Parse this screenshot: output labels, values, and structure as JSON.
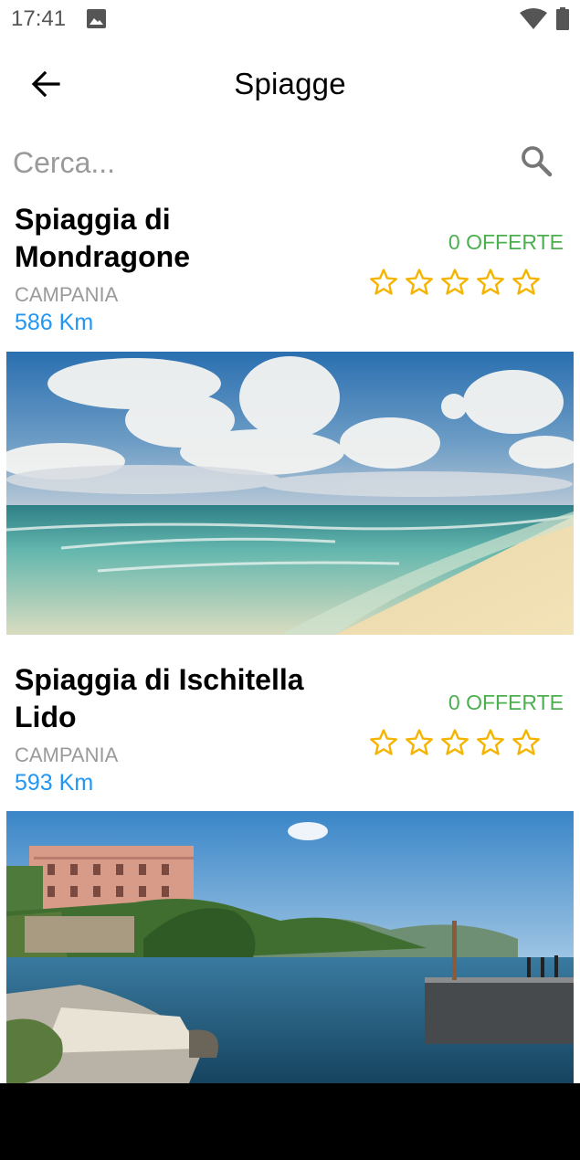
{
  "status_bar": {
    "time": "17:41"
  },
  "app_bar": {
    "title": "Spiagge"
  },
  "search": {
    "placeholder": "Cerca..."
  },
  "beaches": [
    {
      "name": "Spiaggia di Mondragone",
      "region": "CAMPANIA",
      "distance": "586 Km",
      "offers": "0 OFFERTE",
      "rating": 0
    },
    {
      "name": "Spiaggia di Ischitella Lido",
      "region": "CAMPANIA",
      "distance": "593 Km",
      "offers": "0 OFFERTE",
      "rating": 0
    }
  ],
  "colors": {
    "distance": "#2196f3",
    "offers": "#4caf50",
    "star": "#f5b400"
  }
}
